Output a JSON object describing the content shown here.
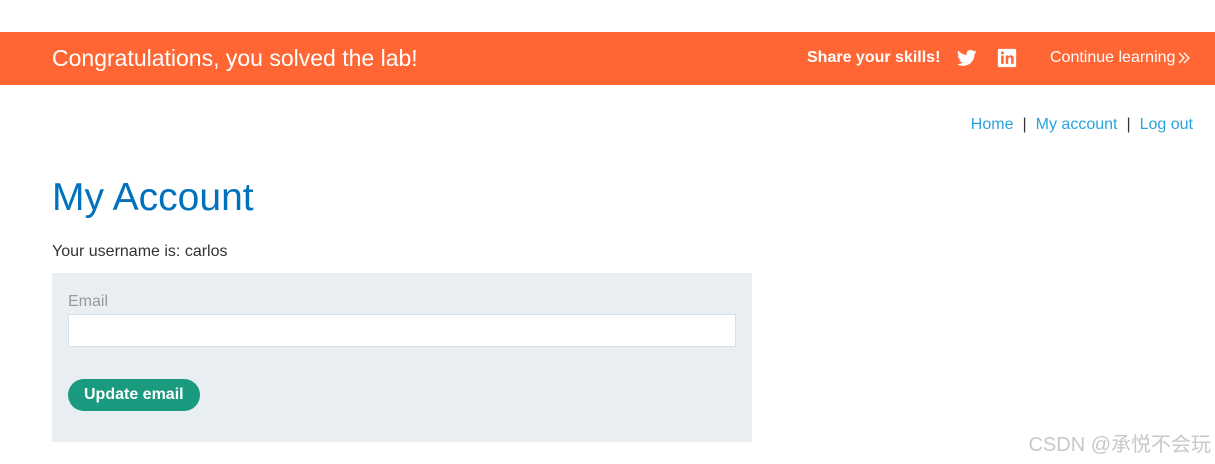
{
  "banner": {
    "message": "Congratulations, you solved the lab!",
    "share_label": "Share your skills!",
    "social_icons": [
      "twitter-icon",
      "linkedin-icon"
    ],
    "continue_label": "Continue learning",
    "background_color": "#ff6633"
  },
  "nav": {
    "home": "Home",
    "separator_1": "|",
    "my_account": "My account",
    "separator_2": "|",
    "log_out": "Log out",
    "link_color": "#29a4dc"
  },
  "page": {
    "title": "My Account",
    "title_color": "#0071bc",
    "username_text": "Your username is: carlos"
  },
  "form": {
    "email_label": "Email",
    "email_value": "",
    "update_button": "Update email",
    "button_color": "#1a9a7e",
    "panel_color": "#e8eef1"
  },
  "watermark": {
    "text": "CSDN @承悦不会玩"
  }
}
